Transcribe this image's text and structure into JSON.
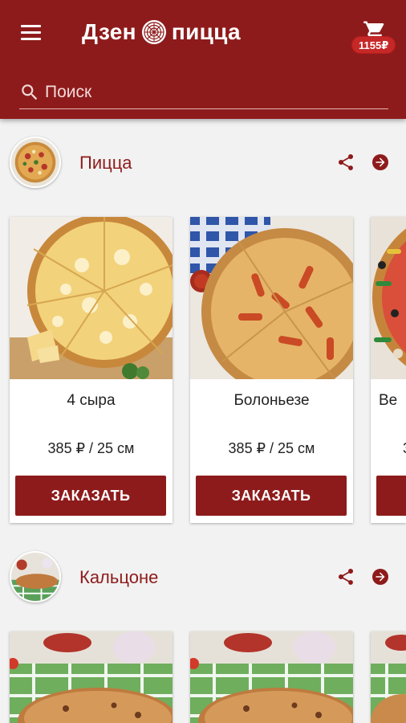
{
  "header": {
    "brand_left": "Дзен",
    "brand_right": "пицца",
    "cart_total": "1155₽",
    "search_placeholder": "Поиск"
  },
  "colors": {
    "primary": "#8e1b1b",
    "badge": "#c62828"
  },
  "categories": [
    {
      "title": "Пицца",
      "products": [
        {
          "name": "4 сыра",
          "price": "385 ₽ / 25 см",
          "button": "ЗАКАЗАТЬ"
        },
        {
          "name": "Болоньезе",
          "price": "385 ₽ / 25 см",
          "button": "ЗАКАЗАТЬ"
        },
        {
          "name": "Ве",
          "price": "3",
          "button": ""
        }
      ]
    },
    {
      "title": "Кальцоне",
      "products": []
    }
  ],
  "icons": [
    "menu-icon",
    "pizza-logo-icon",
    "cart-icon",
    "search-icon",
    "share-icon",
    "arrow-forward-icon"
  ]
}
